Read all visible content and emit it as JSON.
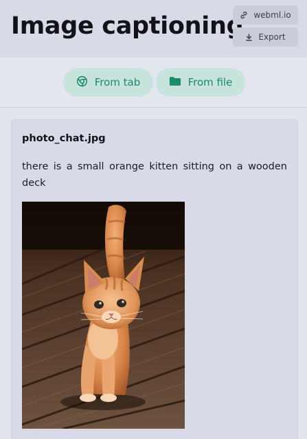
{
  "app": {
    "title": "Image captioning"
  },
  "header": {
    "link_button": {
      "label": "webml.io",
      "icon": "link-icon"
    },
    "export_button": {
      "label": "Export",
      "icon": "download-icon"
    }
  },
  "toolbar": {
    "from_tab": {
      "label": "From tab",
      "icon": "chrome-icon"
    },
    "from_file": {
      "label": "From file",
      "icon": "folder-icon"
    }
  },
  "result": {
    "filename": "photo_chat.jpg",
    "caption": "there is a small orange kitten sitting on a wooden deck",
    "image_subject": "orange kitten on wooden deck"
  },
  "colors": {
    "accent": "#1c8a6e",
    "pill_bg": "#c6e3dc",
    "header_bg": "#d8dbe6",
    "card_bg": "#d8dbe7"
  }
}
